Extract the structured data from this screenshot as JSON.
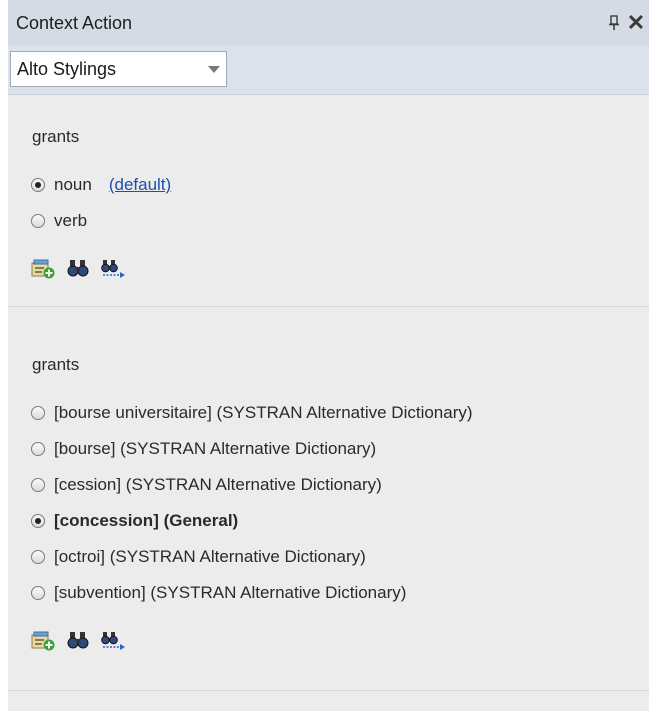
{
  "panel": {
    "title": "Context Action",
    "pin_icon": "pin-icon",
    "close_icon": "close-icon",
    "close_glyph": "✕"
  },
  "toolbar": {
    "select_value": "Alto Stylings"
  },
  "section1": {
    "word": "grants",
    "options": [
      {
        "label": "noun",
        "checked": true,
        "link": "(default)"
      },
      {
        "label": "verb",
        "checked": false
      }
    ],
    "icons": [
      "add-entry-icon",
      "find-icon",
      "find-next-icon"
    ]
  },
  "section2": {
    "word": "grants",
    "options": [
      {
        "label": "[bourse universitaire] (SYSTRAN Alternative Dictionary)",
        "checked": false
      },
      {
        "label": "[bourse] (SYSTRAN Alternative Dictionary)",
        "checked": false
      },
      {
        "label": "[cession] (SYSTRAN Alternative Dictionary)",
        "checked": false
      },
      {
        "label": "[concession] (General)",
        "checked": true
      },
      {
        "label": "[octroi] (SYSTRAN Alternative Dictionary)",
        "checked": false
      },
      {
        "label": "[subvention] (SYSTRAN Alternative Dictionary)",
        "checked": false
      }
    ],
    "icons": [
      "add-entry-icon",
      "find-icon",
      "find-next-icon"
    ]
  }
}
